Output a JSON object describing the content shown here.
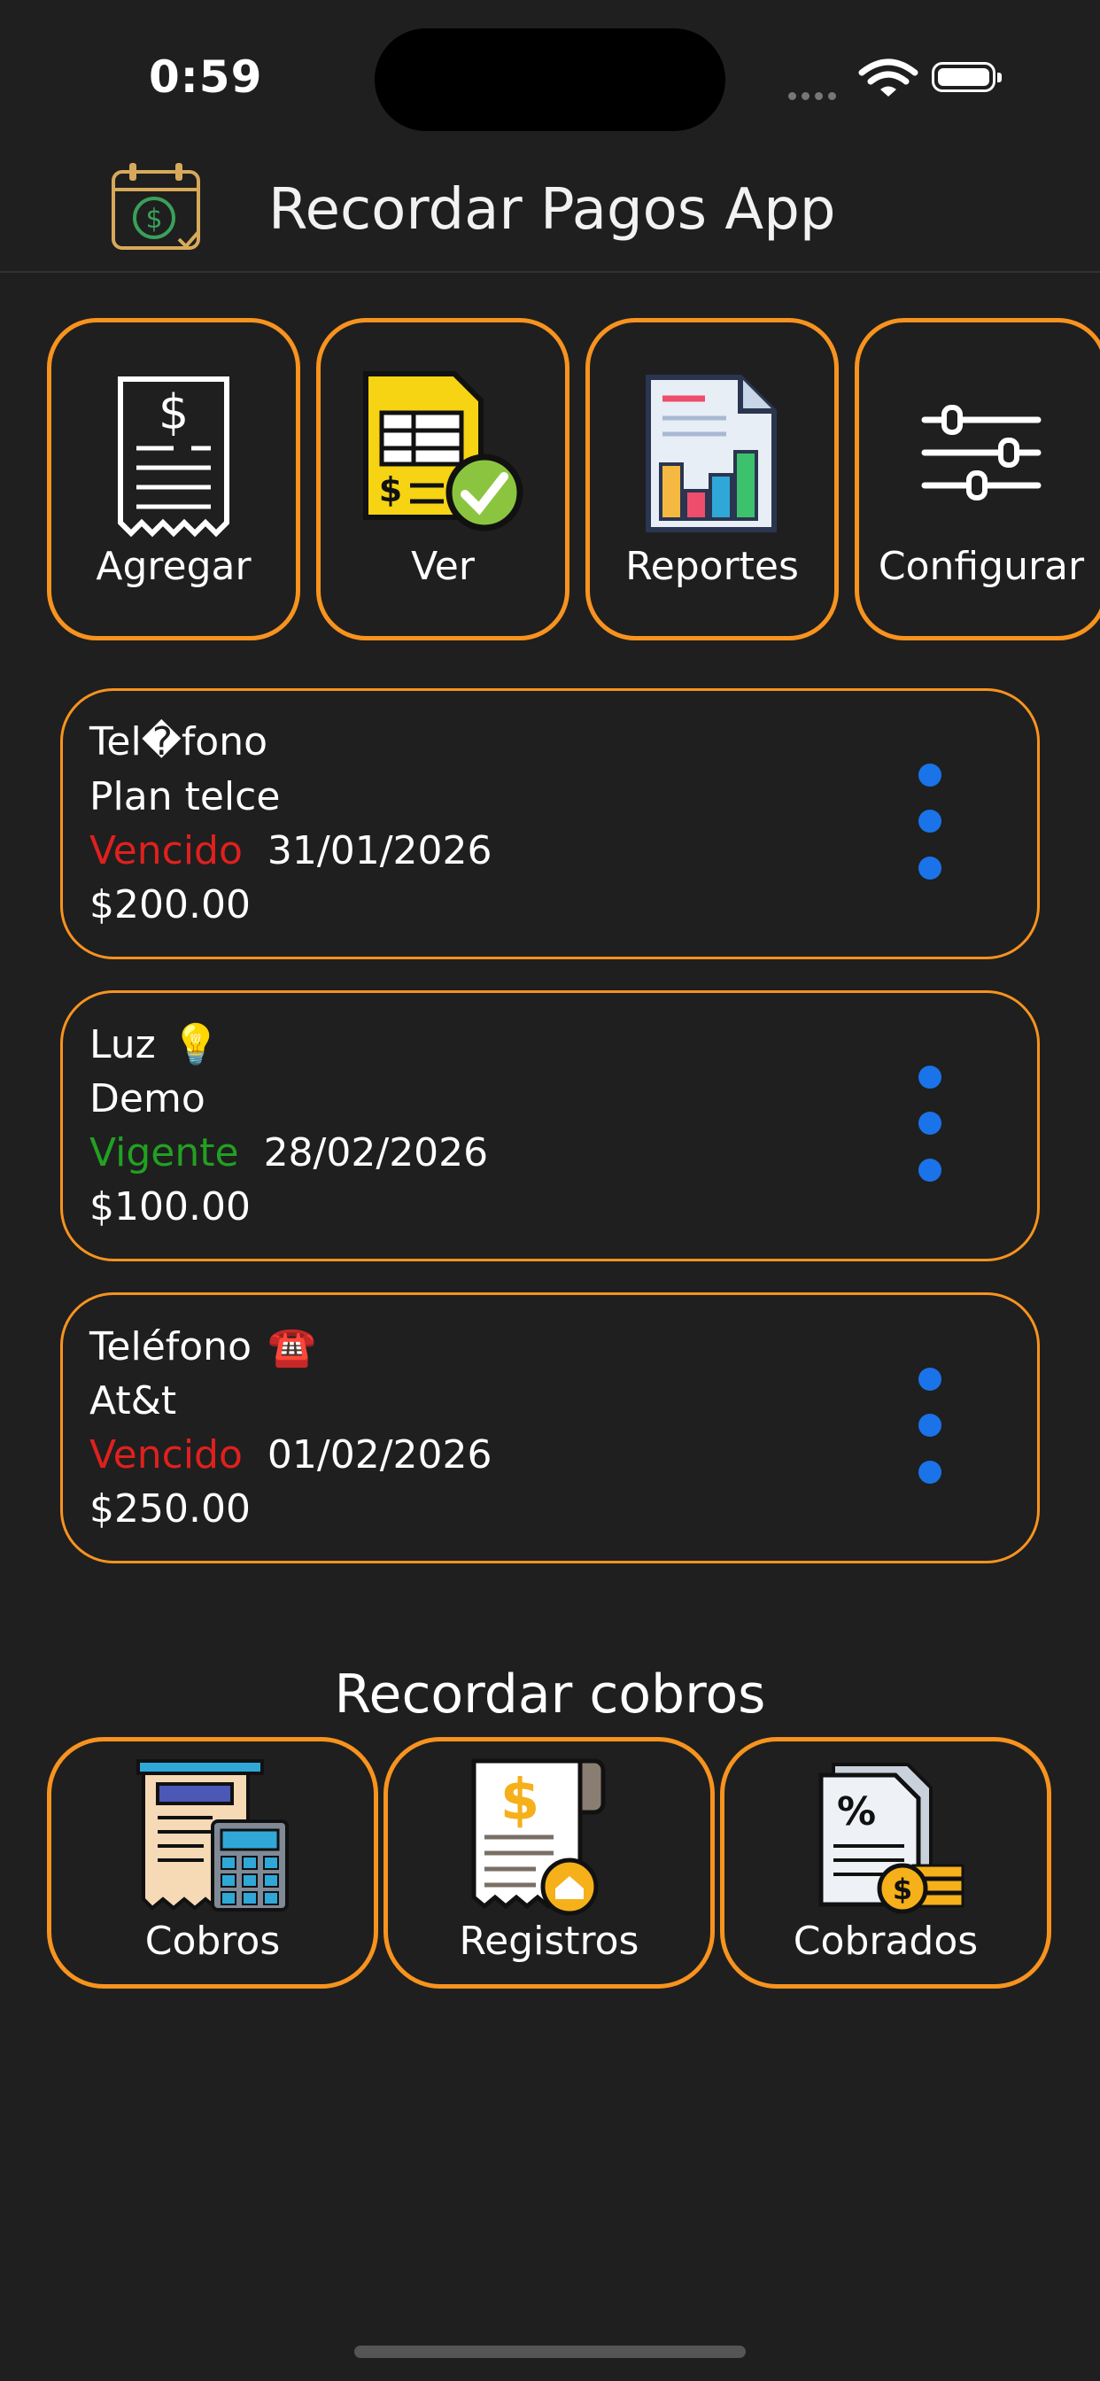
{
  "status_bar": {
    "time": "0:59"
  },
  "header": {
    "title": "Recordar Pagos App",
    "logo_icon": "calendar-dollar-icon"
  },
  "menu": {
    "agregar": "Agregar",
    "ver": "Ver",
    "reportes": "Reportes",
    "configurar": "Configurar"
  },
  "payments": [
    {
      "name": "Tel�fono",
      "emoji": "",
      "description": "Plan telce",
      "status": "Vencido",
      "status_color": "#e0201e",
      "date": "31/01/2026",
      "amount": "$200.00"
    },
    {
      "name": "Luz",
      "emoji": "💡",
      "description": "Demo",
      "status": "Vigente",
      "status_color": "#22a022",
      "date": "28/02/2026",
      "amount": "$100.00"
    },
    {
      "name": "Teléfono",
      "emoji": "☎️",
      "description": "At&t",
      "status": "Vencido",
      "status_color": "#e0201e",
      "date": "01/02/2026",
      "amount": "$250.00"
    }
  ],
  "cobros": {
    "title": "Recordar cobros",
    "cobros": "Cobros",
    "registros": "Registros",
    "cobrados": "Cobrados"
  },
  "colors": {
    "accent": "#f7931e",
    "background": "#1f1f1f",
    "kebab": "#1a73e8"
  }
}
